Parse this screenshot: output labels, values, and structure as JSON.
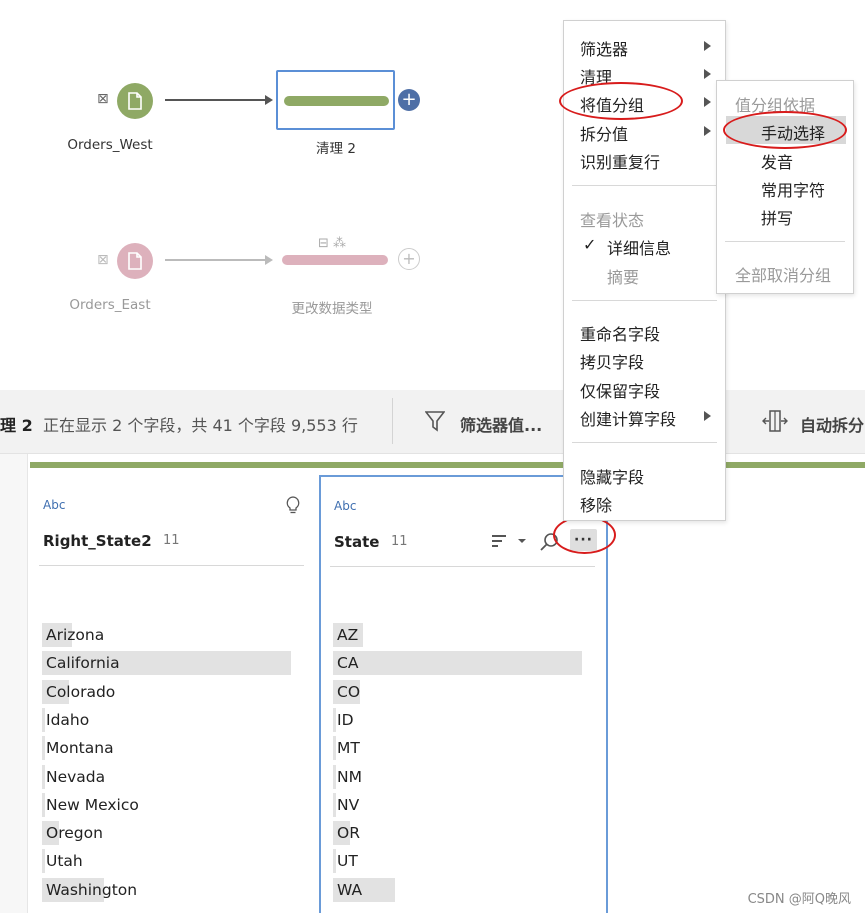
{
  "flow": {
    "west_label": "Orders_West",
    "clean_label": "清理 2",
    "east_label": "Orders_East",
    "change_type_label": "更改数据类型",
    "plus_glyph": "+"
  },
  "toolbar": {
    "step_title": "理 2",
    "status": "正在显示 2 个字段，共 41 个字段  9,553 行",
    "filter_label": "筛选器值...",
    "auto_split_label": "自动拆分"
  },
  "cards": {
    "right_state2": {
      "type_label": "Abc",
      "name": "Right_State2",
      "count": "11",
      "values": [
        {
          "text": "Arizona",
          "fill": 0.12
        },
        {
          "text": "California",
          "fill": 1.0
        },
        {
          "text": "Colorado",
          "fill": 0.11
        },
        {
          "text": "Idaho",
          "fill": 0.01
        },
        {
          "text": "Montana",
          "fill": 0.01
        },
        {
          "text": "Nevada",
          "fill": 0.01
        },
        {
          "text": "New Mexico",
          "fill": 0.01
        },
        {
          "text": "Oregon",
          "fill": 0.07
        },
        {
          "text": "Utah",
          "fill": 0.01
        },
        {
          "text": "Washington",
          "fill": 0.25
        }
      ]
    },
    "state": {
      "type_label": "Abc",
      "name": "State",
      "count": "11",
      "more_glyph": "···",
      "values": [
        {
          "text": "AZ",
          "fill": 0.12
        },
        {
          "text": "CA",
          "fill": 1.0
        },
        {
          "text": "CO",
          "fill": 0.11
        },
        {
          "text": "ID",
          "fill": 0.01
        },
        {
          "text": "MT",
          "fill": 0.01
        },
        {
          "text": "NM",
          "fill": 0.01
        },
        {
          "text": "NV",
          "fill": 0.01
        },
        {
          "text": "OR",
          "fill": 0.07
        },
        {
          "text": "UT",
          "fill": 0.01
        },
        {
          "text": "WA",
          "fill": 0.25
        }
      ]
    }
  },
  "context_menu": {
    "filter": "筛选器",
    "clean": "清理",
    "group_values": "将值分组",
    "split_values": "拆分值",
    "identify_duplicates": "识别重复行",
    "view_state": "查看状态",
    "check": "✓",
    "details": "详细信息",
    "summary": "摘要",
    "rename": "重命名字段",
    "copy": "拷贝字段",
    "keep_only": "仅保留字段",
    "create_calc": "创建计算字段",
    "hide": "隐藏字段",
    "remove": "移除"
  },
  "submenu": {
    "header": "值分组依据",
    "manual": "手动选择",
    "pronunciation": "发音",
    "common_chars": "常用字符",
    "spelling": "拼写",
    "ungroup_all": "全部取消分组"
  },
  "watermark": "CSDN @阿Q晚风",
  "colors": {
    "accent_green": "#8fa965",
    "input_pink": "#ddb1bc",
    "selection_blue": "#5b8fd6",
    "plus_blue": "#4e6fa6",
    "annotation_red": "#d81c1c"
  }
}
